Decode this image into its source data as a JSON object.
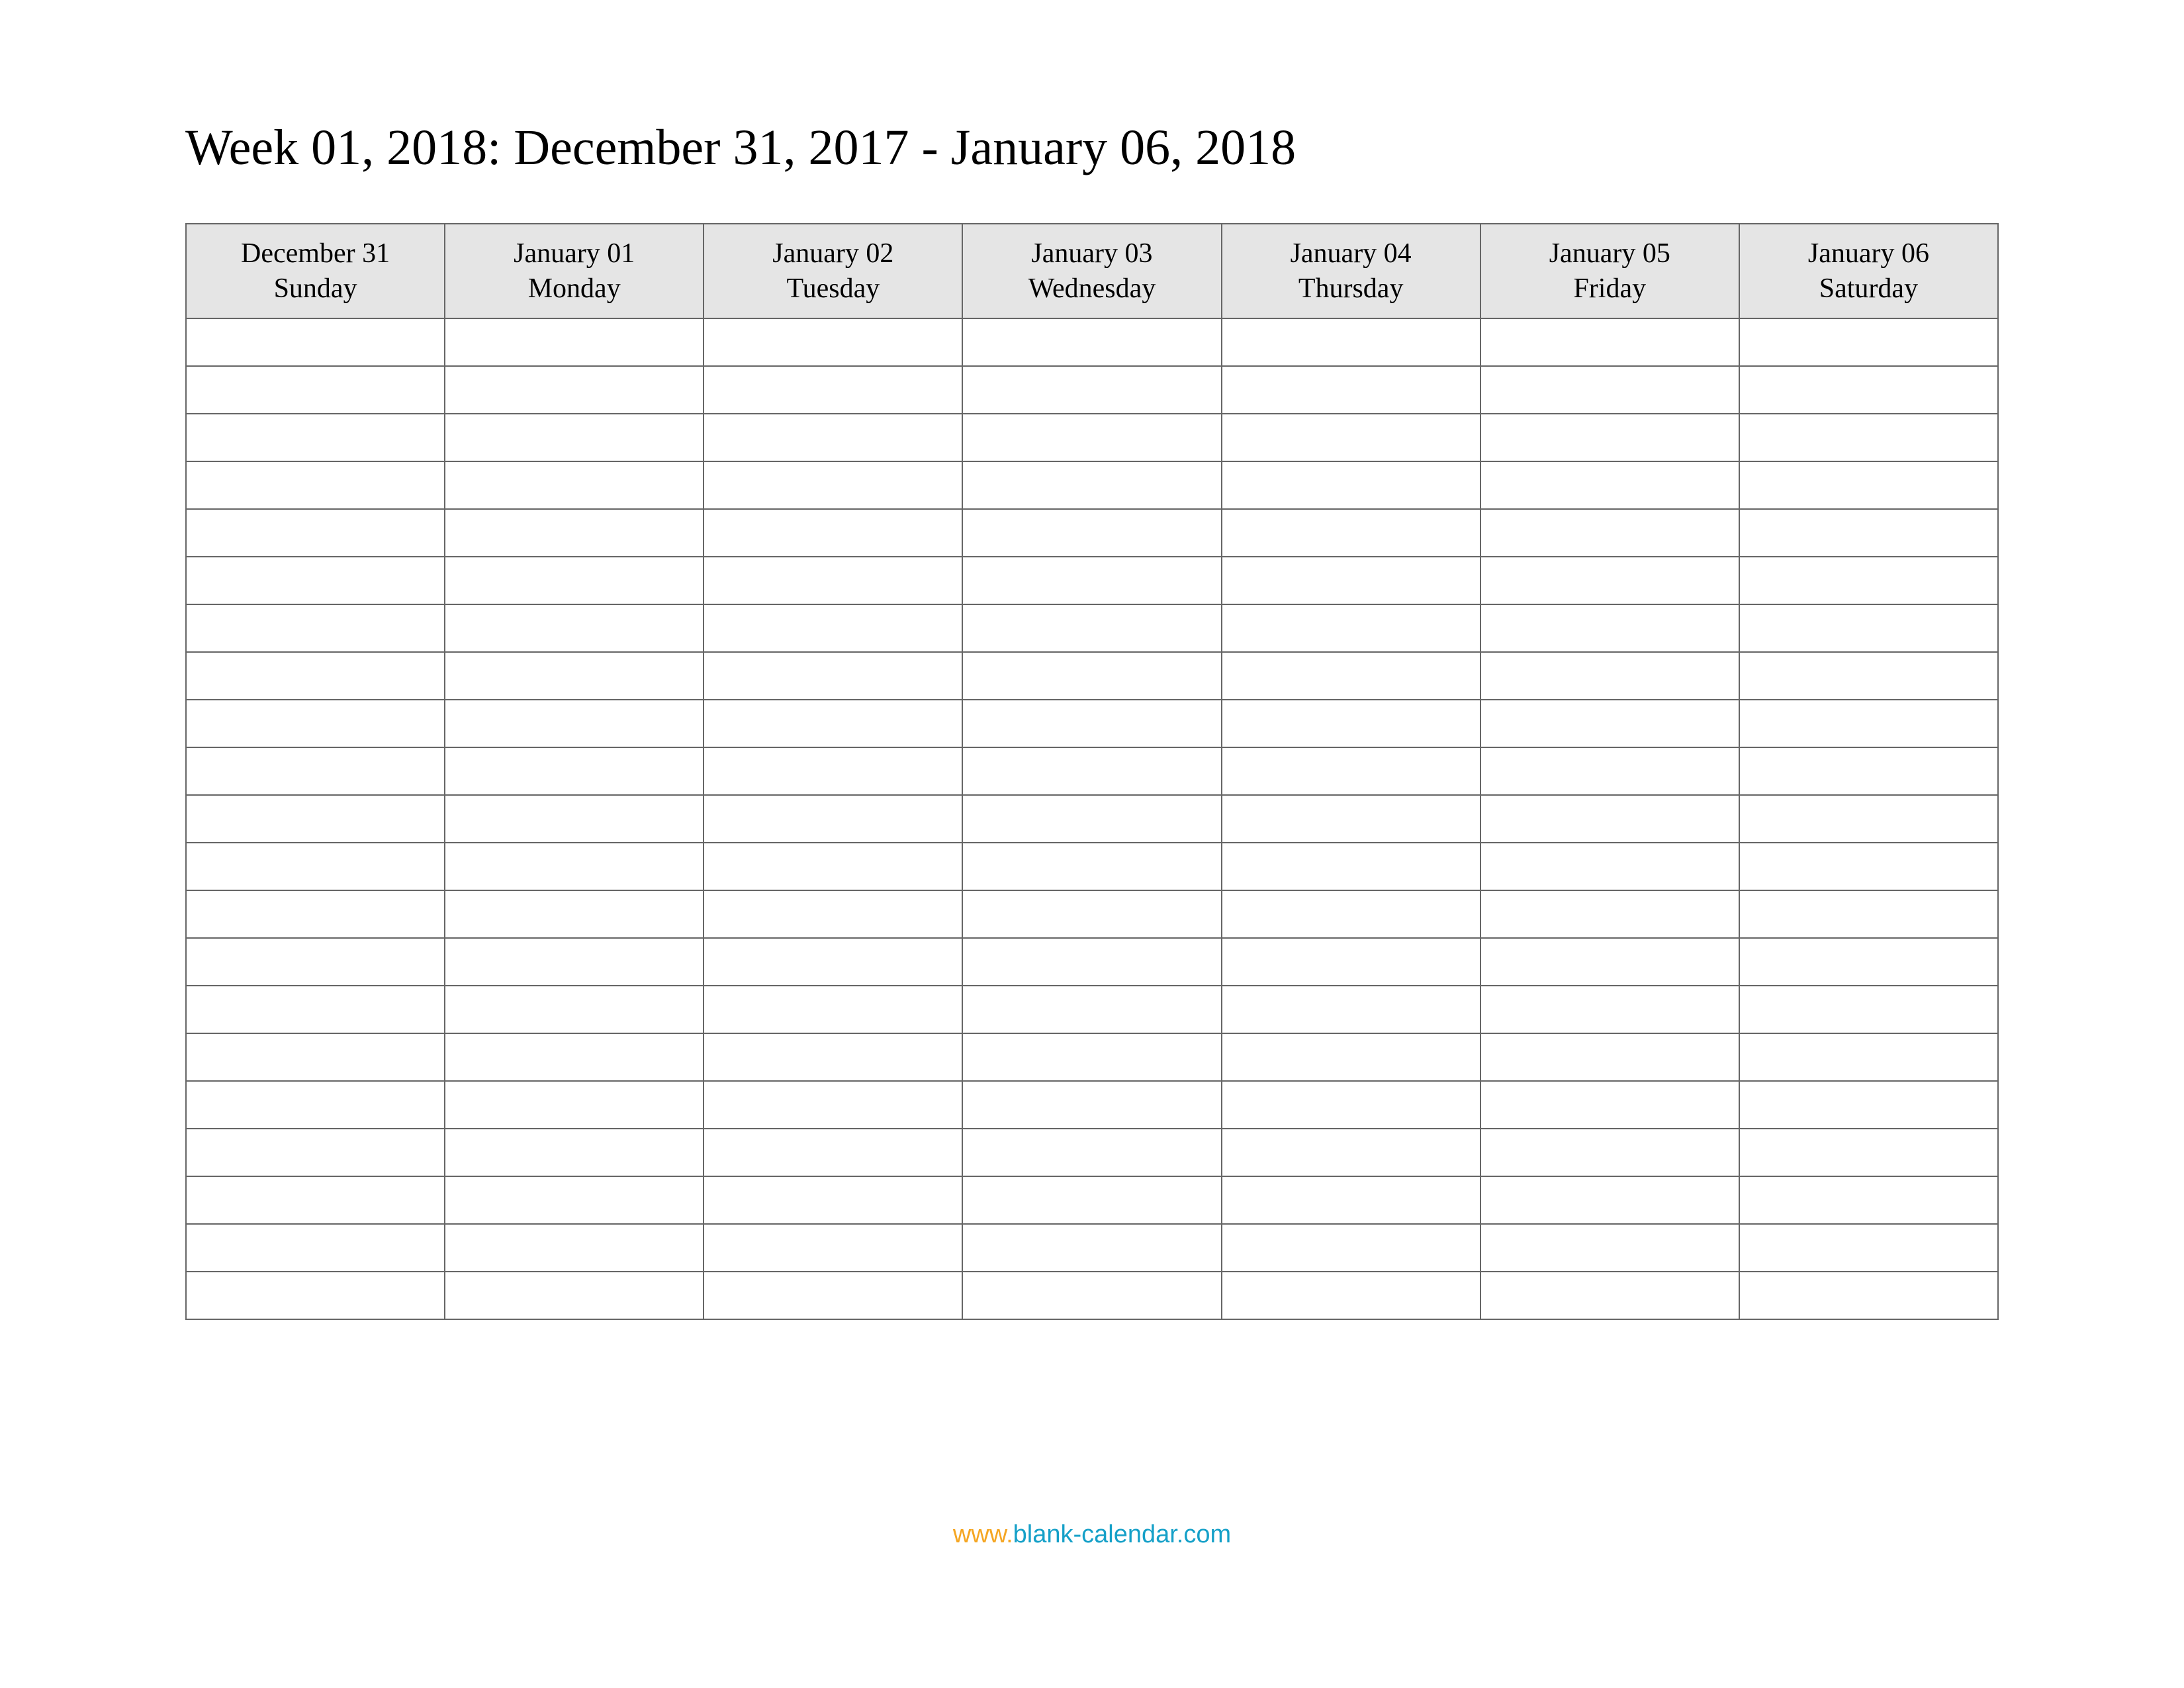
{
  "title": "Week 01, 2018: December 31, 2017 - January 06, 2018",
  "days": [
    {
      "date": "December 31",
      "weekday": "Sunday"
    },
    {
      "date": "January 01",
      "weekday": "Monday"
    },
    {
      "date": "January 02",
      "weekday": "Tuesday"
    },
    {
      "date": "January 03",
      "weekday": "Wednesday"
    },
    {
      "date": "January 04",
      "weekday": "Thursday"
    },
    {
      "date": "January 05",
      "weekday": "Friday"
    },
    {
      "date": "January 06",
      "weekday": "Saturday"
    }
  ],
  "rows_count": 21,
  "footer": {
    "prefix": "www.",
    "domain": "blank-calendar.com"
  }
}
